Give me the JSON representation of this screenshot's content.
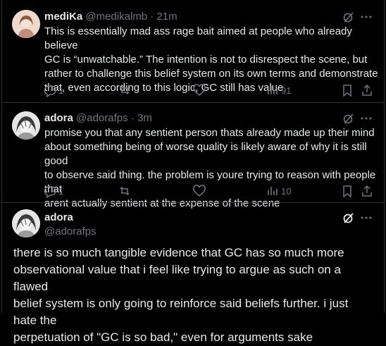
{
  "tweets": [
    {
      "name": "mediKa",
      "handle": "@medikalmb",
      "dot": "·",
      "time": "21m",
      "lines": [
        "This is essentially mad ass rage bait aimed at people who already believe",
        "GC is “unwatchable.” The intention is not to disrespect the scene, but",
        "rather to challenge this belief system on its own terms and demonstrate",
        "that, even according to this logic, GC still has value"
      ],
      "replies": "1",
      "views": "91",
      "avatar_color": "#e8c5b8"
    },
    {
      "name": "adora",
      "handle": "@adorafps",
      "dot": "·",
      "time": "3m",
      "lines": [
        "promise you that any sentient person thats already made up their mind",
        "about something being of worse quality is likely aware of why it is still good",
        "to observe said thing. the problem is youre trying to reason with people that",
        "arent actually sentient at the expense of the scene"
      ],
      "replies": "1",
      "views": "10",
      "avatar_color": "#d9d9d9"
    }
  ],
  "focused": {
    "name": "adora",
    "handle": "@adorafps",
    "lines": [
      "there is so much tangible evidence that GC has so much more",
      "observational value that i feel like trying to argue as such on a flawed",
      "belief system is only going to reinforce said beliefs further. i just hate the",
      "perpetuation of \"GC is so bad,\" even for arguments sake"
    ]
  },
  "icons": {
    "grok": "grok-icon",
    "more": "more-icon",
    "reply": "reply-icon",
    "retweet": "retweet-icon",
    "like": "like-icon",
    "views": "views-icon",
    "bookmark": "bookmark-icon",
    "share": "share-icon"
  }
}
